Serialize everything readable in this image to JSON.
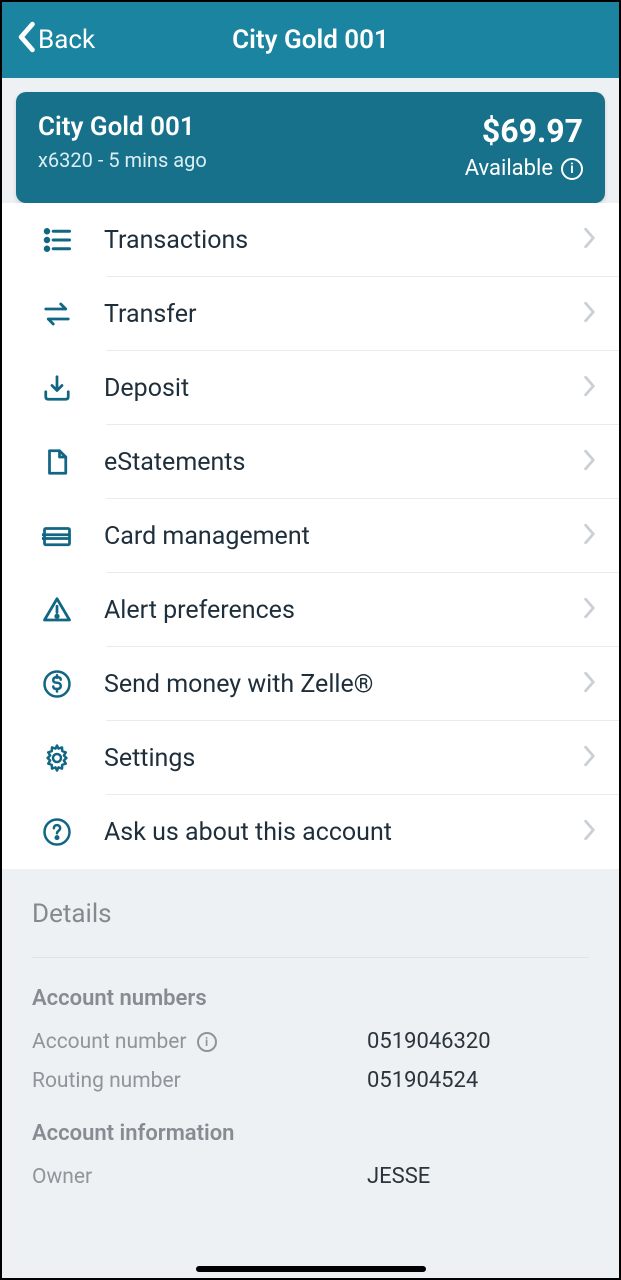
{
  "nav": {
    "back_label": "Back",
    "title": "City Gold 001"
  },
  "account": {
    "name": "City Gold 001",
    "subtitle": "x6320 - 5 mins ago",
    "balance": "$69.97",
    "available_label": "Available"
  },
  "menu": [
    {
      "id": "transactions",
      "label": "Transactions",
      "icon": "list-icon"
    },
    {
      "id": "transfer",
      "label": "Transfer",
      "icon": "transfer-icon"
    },
    {
      "id": "deposit",
      "label": "Deposit",
      "icon": "deposit-icon"
    },
    {
      "id": "estatements",
      "label": "eStatements",
      "icon": "document-icon"
    },
    {
      "id": "card-management",
      "label": "Card management",
      "icon": "card-icon"
    },
    {
      "id": "alert-preferences",
      "label": "Alert preferences",
      "icon": "alert-icon"
    },
    {
      "id": "send-zelle",
      "label": "Send money with Zelle®",
      "icon": "dollar-circle-icon"
    },
    {
      "id": "settings",
      "label": "Settings",
      "icon": "gear-icon"
    },
    {
      "id": "ask-us",
      "label": "Ask us about this account",
      "icon": "question-circle-icon"
    }
  ],
  "details": {
    "title": "Details",
    "account_numbers_title": "Account numbers",
    "account_number_label": "Account number",
    "account_number_value": "0519046320",
    "routing_number_label": "Routing number",
    "routing_number_value": "051904524",
    "account_info_title": "Account information",
    "owner_label": "Owner",
    "owner_value": "JESSE"
  }
}
